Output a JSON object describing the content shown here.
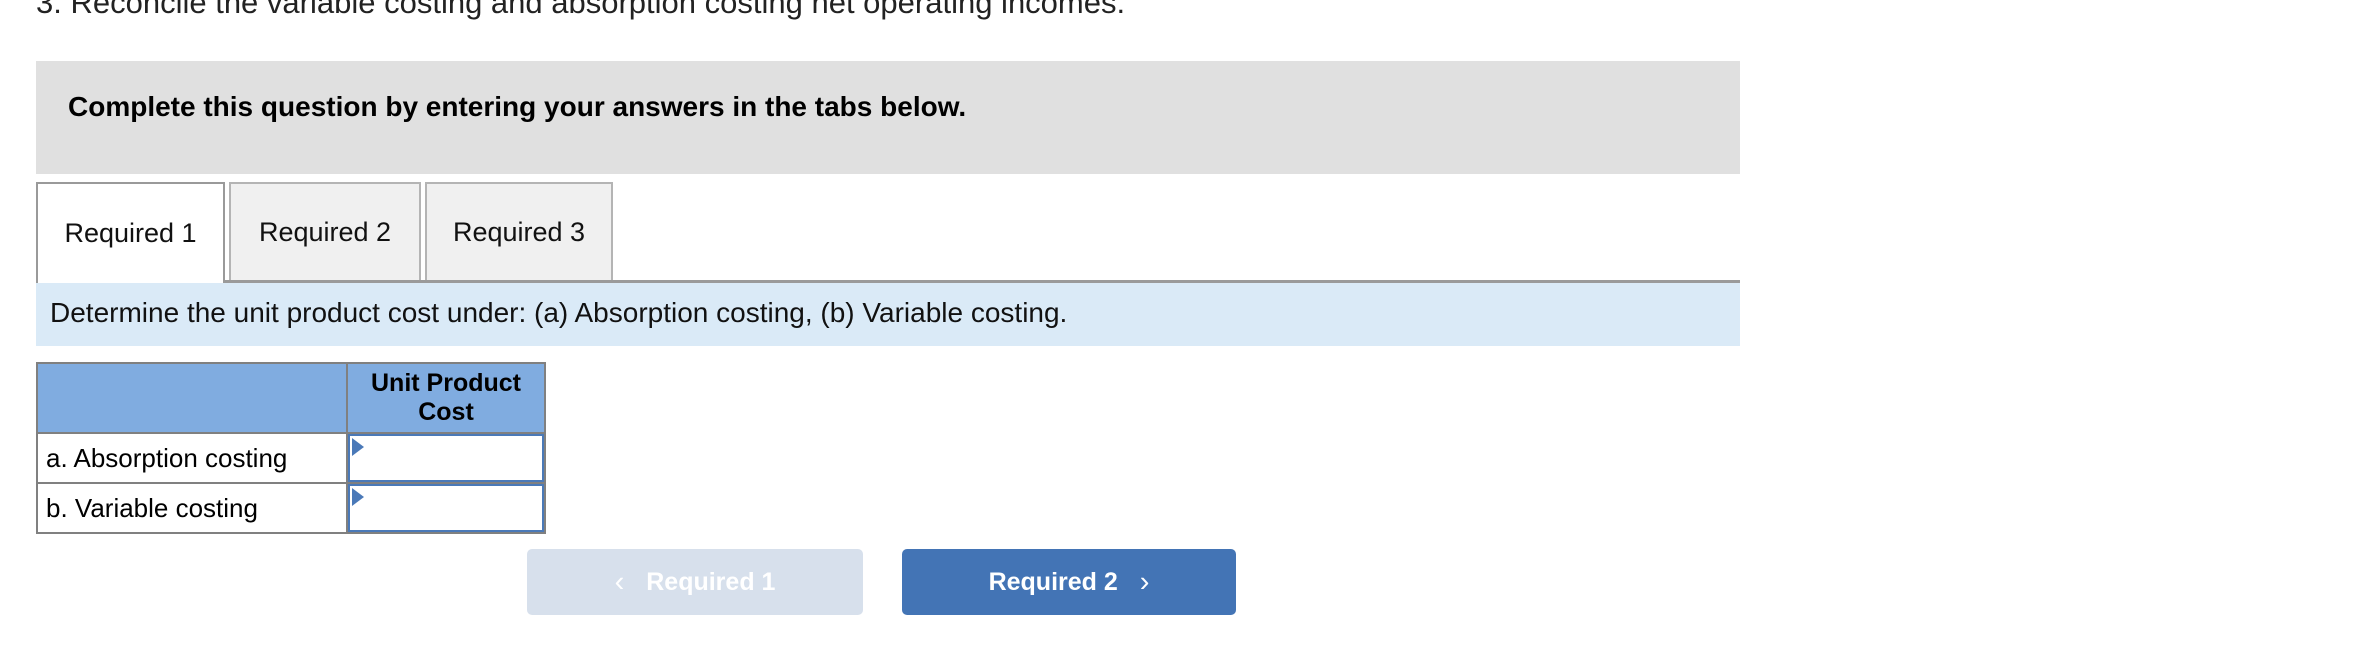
{
  "question": {
    "text": "3. Reconcile the variable costing and absorption costing net operating incomes."
  },
  "banner": {
    "text": "Complete this question by entering your answers in the tabs below."
  },
  "tabs": [
    {
      "label": "Required 1",
      "active": true
    },
    {
      "label": "Required 2",
      "active": false
    },
    {
      "label": "Required 3",
      "active": false
    }
  ],
  "requirement_bar": {
    "text": "Determine the unit product cost under: (a) Absorption costing, (b) Variable costing."
  },
  "table": {
    "headers": [
      "",
      "Unit Product Cost"
    ],
    "rows": [
      {
        "label": "a. Absorption costing",
        "value": ""
      },
      {
        "label": "b. Variable costing",
        "value": ""
      }
    ]
  },
  "nav": {
    "prev_label": "Required 1",
    "next_label": "Required 2",
    "prev_icon": "chevron-left-icon",
    "next_icon": "chevron-right-icon",
    "prev_chevron": "‹",
    "next_chevron": "›"
  },
  "colors": {
    "banner_gray": "#e0e0e0",
    "requirement_blue": "#daeaf7",
    "table_header_blue": "#80ace0",
    "input_border_blue": "#4a79b8",
    "button_active_blue": "#4374b5",
    "button_disabled_blue": "#d7e0ec",
    "tab_inactive_gray": "#f0f0f0",
    "border_gray": "#808080"
  }
}
